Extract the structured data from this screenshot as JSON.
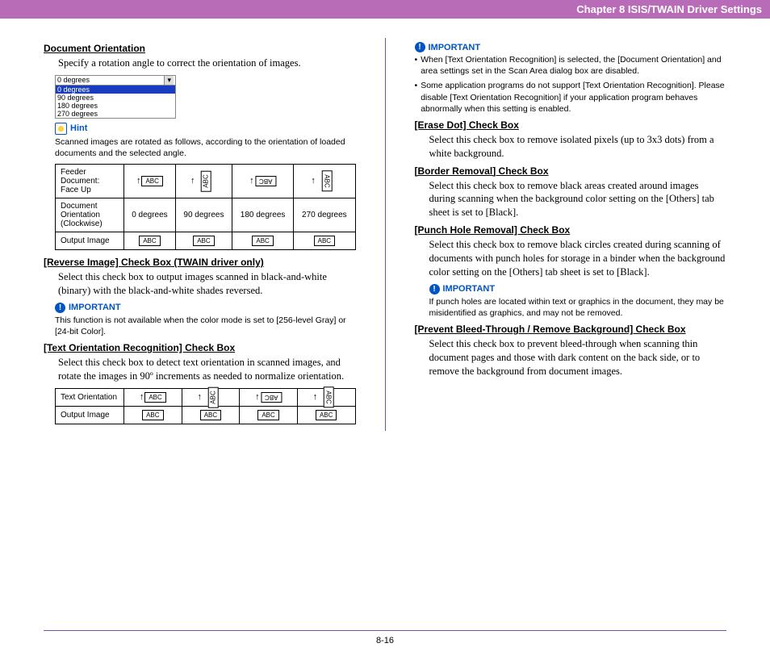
{
  "header": {
    "chapter": "Chapter 8   ISIS/TWAIN Driver Settings"
  },
  "left": {
    "h1": "Document Orientation",
    "p1": "Specify a rotation angle to correct the orientation of images.",
    "dropdown": {
      "top": "0 degrees",
      "sel": "0 degrees",
      "opts": [
        "90 degrees",
        "180 degrees",
        "270 degrees"
      ]
    },
    "hint": "Hint",
    "hint_text": "Scanned images are rotated as follows, according to the orientation of loaded documents and the selected angle.",
    "table1": {
      "r1": "Feeder Document: Face Up",
      "r2": "Document Orientation (Clockwise)",
      "r2v": [
        "0 degrees",
        "90 degrees",
        "180 degrees",
        "270 degrees"
      ],
      "r3": "Output Image",
      "abc": "ABC"
    },
    "h2": "[Reverse Image] Check Box (TWAIN driver only)",
    "p2": "Select this check box to output images scanned in black-and-white (binary) with the black-and-white shades reversed.",
    "imp1": "IMPORTANT",
    "imp1_text": "This function is not available when the color mode is set to [256-level Gray] or [24-bit Color].",
    "h3": "[Text Orientation Recognition] Check Box",
    "p3": "Select this check box to detect text orientation in scanned images, and rotate the images in 90º increments as needed to normalize orientation.",
    "table2": {
      "r1": "Text Orientation",
      "r2": "Output Image",
      "abc": "ABC"
    }
  },
  "right": {
    "imp1": "IMPORTANT",
    "imp1_b1": "When [Text Orientation Recognition] is selected, the [Document Orientation] and area settings set in the Scan Area dialog box are disabled.",
    "imp1_b2": "Some application programs do not support [Text Orientation Recognition]. Please disable [Text Orientation Recognition] if your application program behaves abnormally when this setting is enabled.",
    "h1": "[Erase Dot] Check Box",
    "p1": "Select this check box to remove isolated pixels (up to 3x3 dots) from a white background.",
    "h2": "[Border Removal] Check Box",
    "p2": "Select this check box to remove black areas created around images during scanning when the background color setting on the [Others] tab sheet is set to [Black].",
    "h3": "[Punch Hole Removal] Check Box",
    "p3": "Select this check box to remove black circles created during scanning of documents with punch holes for storage in a binder when the background color setting on the [Others] tab sheet is set to [Black].",
    "imp2": "IMPORTANT",
    "imp2_text": "If punch holes are located within text or graphics in the document, they may be misidentified as graphics, and may not be removed.",
    "h4": "[Prevent Bleed-Through / Remove Background] Check Box",
    "p4": "Select this check box to prevent bleed-through when scanning thin document pages and those with dark content on the back side, or to remove the background from document images."
  },
  "footer": {
    "page": "8-16"
  }
}
